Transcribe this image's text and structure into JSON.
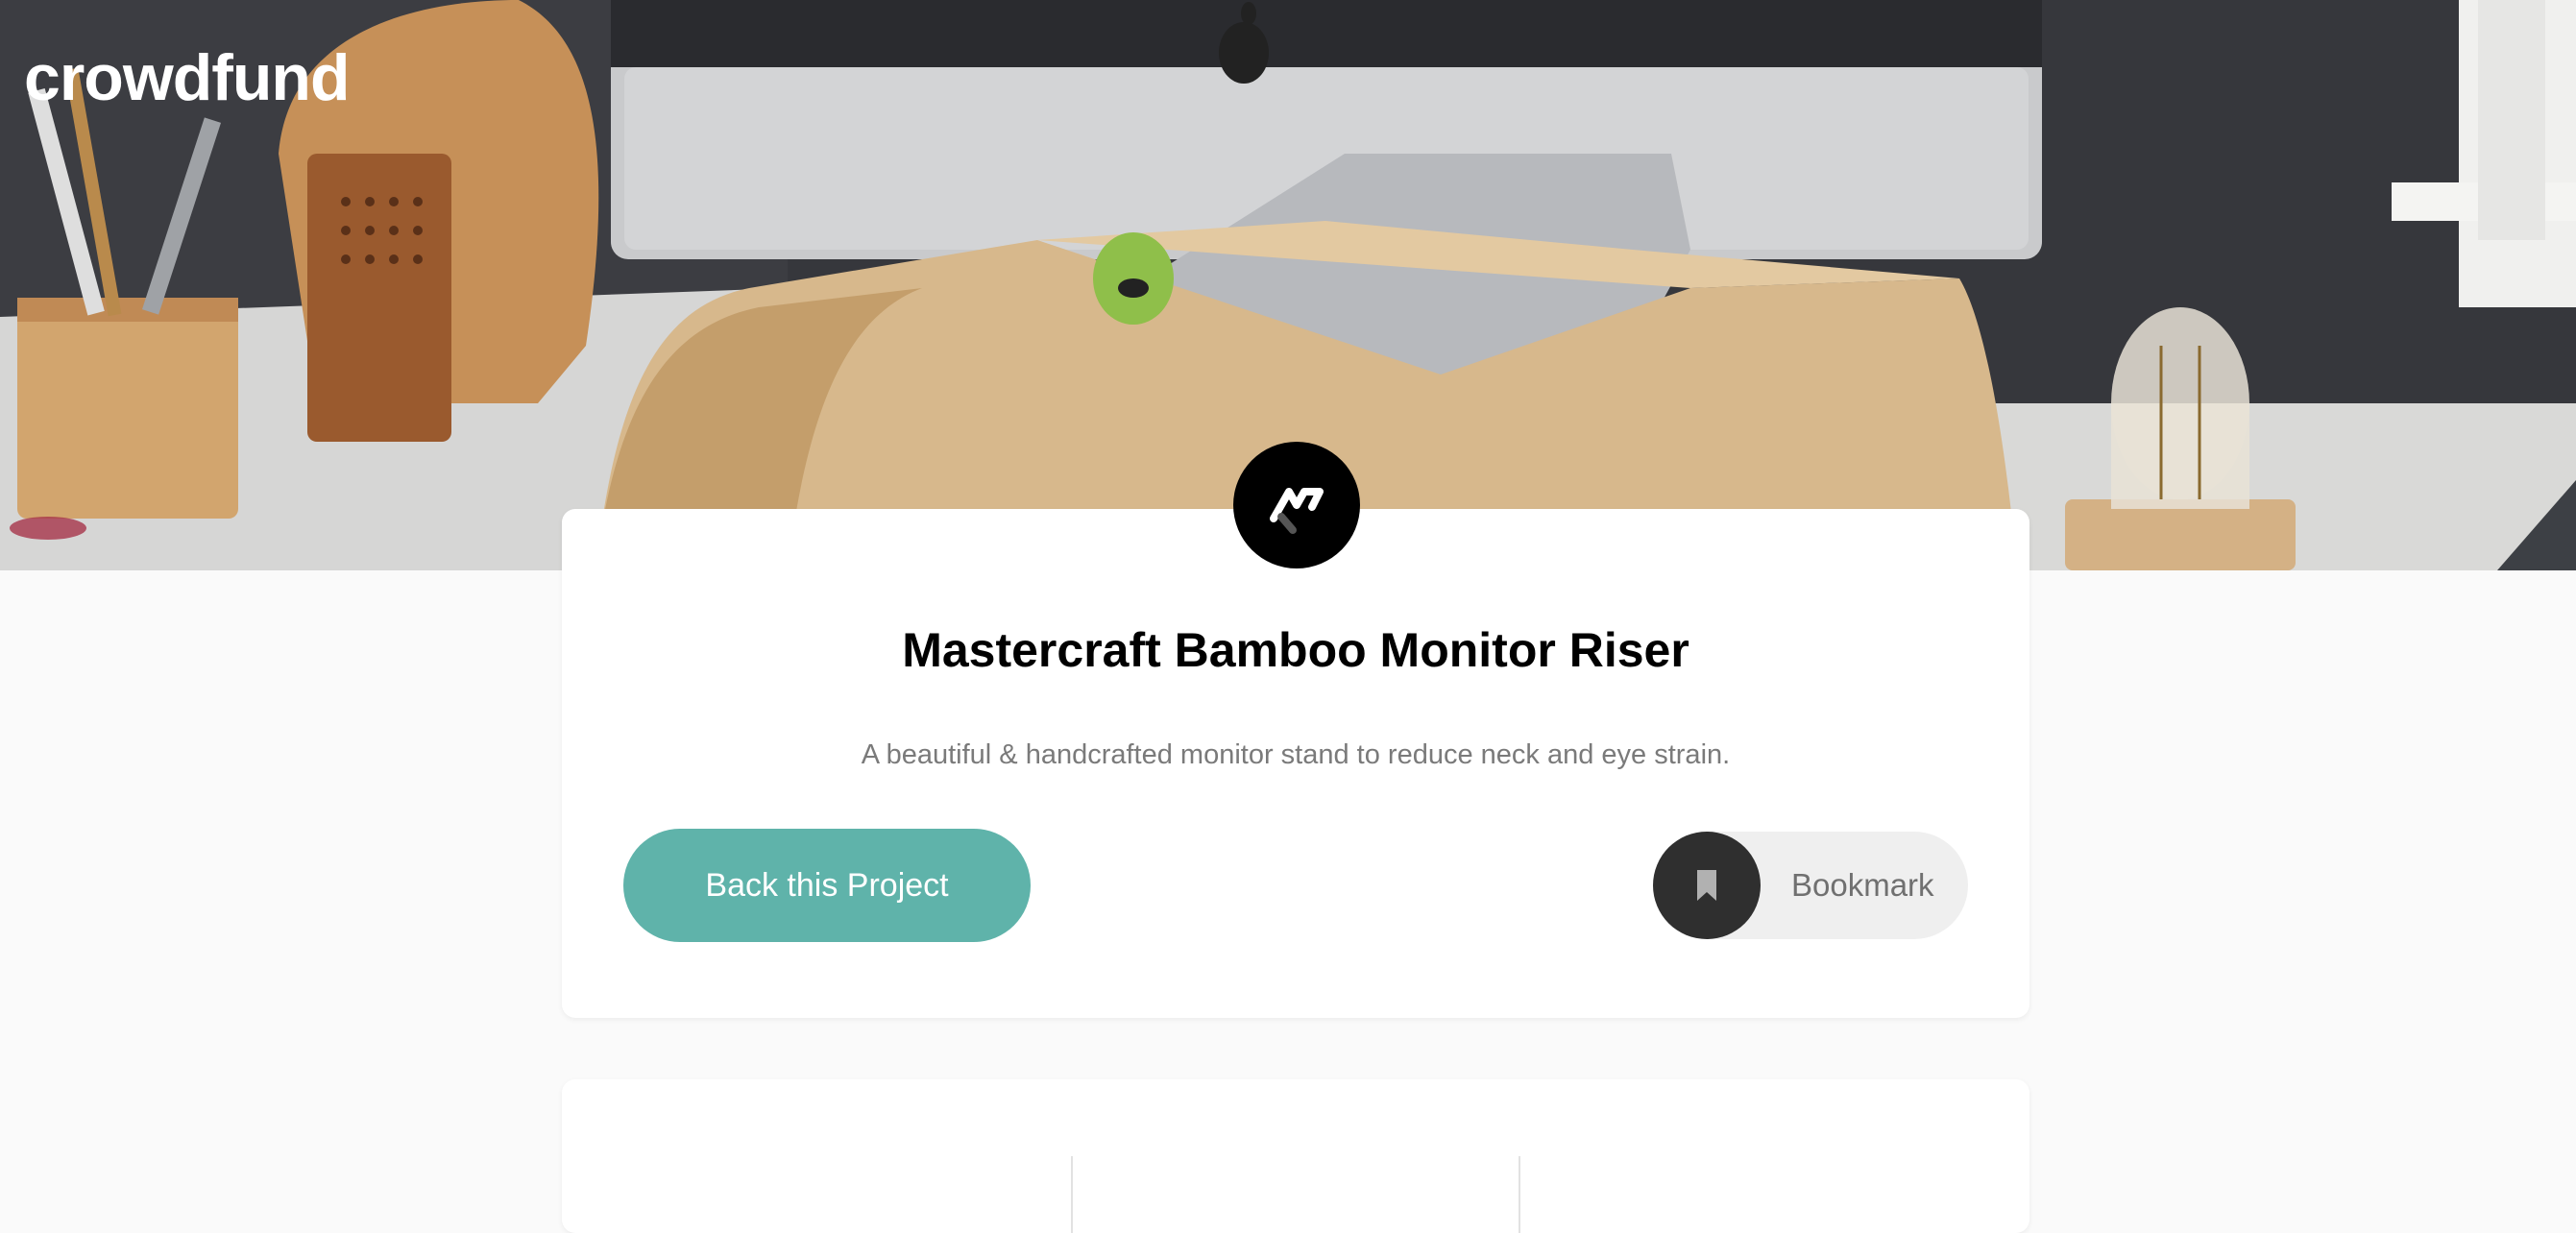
{
  "site": {
    "logo_text": "crowdfund"
  },
  "project": {
    "title": "Mastercraft Bamboo Monitor Riser",
    "description": "A beautiful & handcrafted monitor stand to reduce neck and eye strain.",
    "brand_logo_icon": "mastercraft-logo-icon"
  },
  "actions": {
    "back_label": "Back this Project",
    "bookmark_label": "Bookmark",
    "bookmark_icon": "bookmark-icon"
  },
  "colors": {
    "accent": "#5fb3aa",
    "bookmark_circle": "#2f2f2f",
    "page_bg": "#fafafa"
  }
}
